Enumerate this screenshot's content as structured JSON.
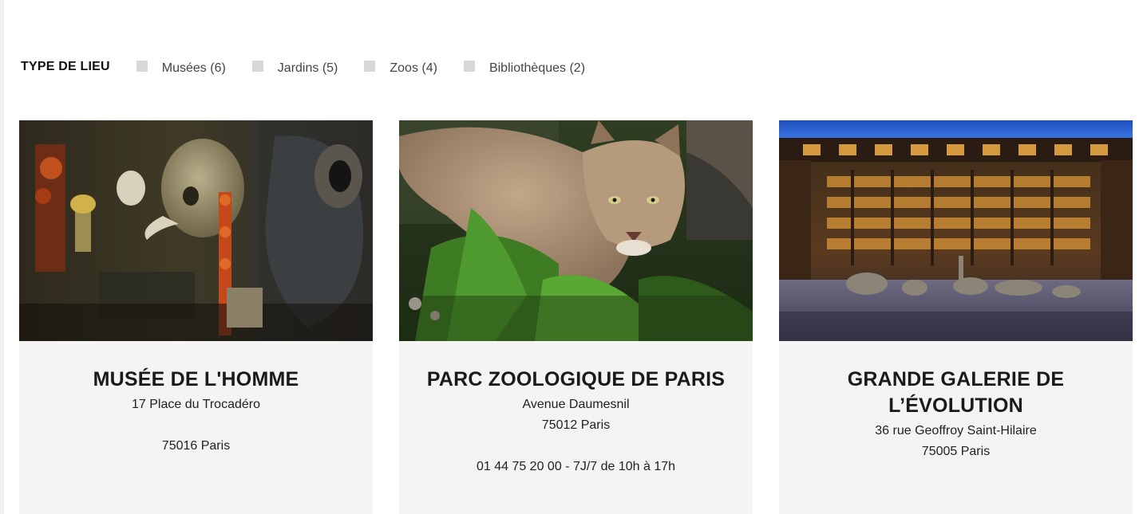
{
  "filters": {
    "title": "TYPE DE LIEU",
    "options": [
      {
        "label": "Musées (6)",
        "checked": false
      },
      {
        "label": "Jardins (5)",
        "checked": false
      },
      {
        "label": "Zoos (4)",
        "checked": false
      },
      {
        "label": "Bibliothèques (2)",
        "checked": false
      }
    ]
  },
  "cards": [
    {
      "title": "MUSÉE DE L'HOMME",
      "address": "17 Place du Trocadéro",
      "city": "75016 Paris",
      "image": "museum-skull-exhibit"
    },
    {
      "title": "PARC ZOOLOGIQUE DE PARIS",
      "address": "Avenue Daumesnil",
      "city": "75012 Paris",
      "phone_hours": "01 44 75 20 00 - 7J/7 de 10h à 17h",
      "image": "puma-in-grass"
    },
    {
      "title": "GRANDE GALERIE DE L’ÉVOLUTION",
      "address": "36 rue Geoffroy Saint-Hilaire",
      "city": "75005 Paris",
      "image": "evolution-gallery-hall"
    }
  ],
  "colors": {
    "card_bg": "#f4f4f4",
    "checkbox": "#d8d8d8",
    "text": "#1f1f1f"
  }
}
